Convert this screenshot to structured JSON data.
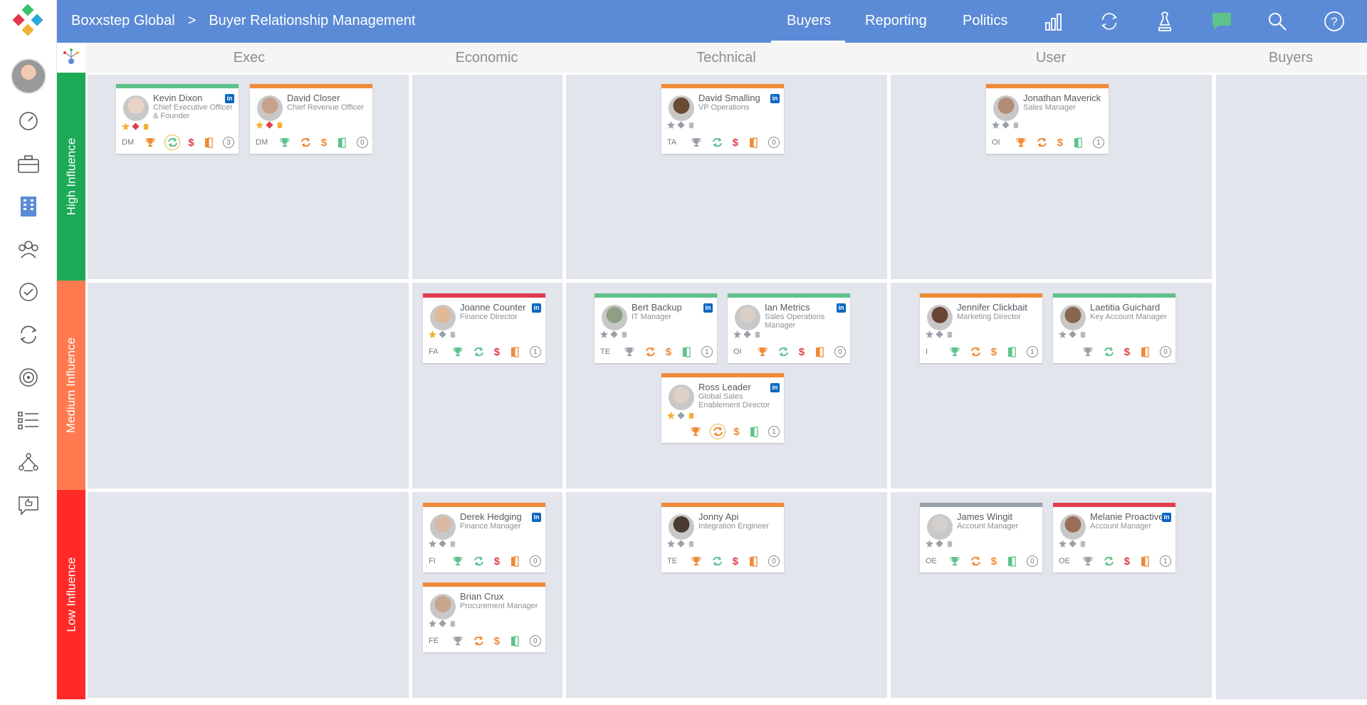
{
  "header": {
    "org": "Boxxstep Global",
    "separator": ">",
    "page": "Buyer Relationship Management",
    "tabs": [
      "Buyers",
      "Reporting",
      "Politics"
    ],
    "active_tab": "Buyers"
  },
  "columns": [
    "Exec",
    "Economic",
    "Technical",
    "User",
    "Buyers"
  ],
  "rows": [
    {
      "label": "High Influence",
      "color": "#1daa57"
    },
    {
      "label": "Medium Influence",
      "color": "#ff7a4e"
    },
    {
      "label": "Low Influence",
      "color": "#ff2a27"
    }
  ],
  "colors": {
    "topbar": "#5b8bd6",
    "green": "#5fc28c",
    "orange": "#ef8b38",
    "red": "#e23d4e",
    "gray": "#9aa0a8",
    "cell": "#e3e5ec"
  },
  "cards": [
    {
      "name": "Kevin Dixon",
      "title": "Chief Executive Officer & Founder",
      "code": "DM",
      "count": "3",
      "bar": "green",
      "linkedin": true,
      "photo_tone": "#e9d3c6"
    },
    {
      "name": "David Closer",
      "title": "Chief Revenue Officer",
      "code": "DM",
      "count": "0",
      "bar": "orange",
      "linkedin": false,
      "photo_tone": "#c7a28a"
    },
    {
      "name": "David Smalling",
      "title": "VP Operations",
      "code": "TA",
      "count": "0",
      "bar": "orange",
      "linkedin": true,
      "photo_tone": "#6b4a36"
    },
    {
      "name": "Jonathan Maverick",
      "title": "Sales Manager",
      "code": "OI",
      "count": "1",
      "bar": "orange",
      "linkedin": false,
      "photo_tone": "#b18b73"
    },
    {
      "name": "Joanne Counter",
      "title": "Finance Director",
      "code": "FA",
      "count": "1",
      "bar": "red",
      "linkedin": true,
      "photo_tone": "#e1b997"
    },
    {
      "name": "Bert Backup",
      "title": "IT Manager",
      "code": "TE",
      "count": "1",
      "bar": "green",
      "linkedin": true,
      "photo_tone": "#8e9f86"
    },
    {
      "name": "Ian Metrics",
      "title": "Sales Operations Manager",
      "code": "OI",
      "count": "0",
      "bar": "green",
      "linkedin": true,
      "photo_tone": "#d7cfc8"
    },
    {
      "name": "Jennifer Clickbait",
      "title": "Marketing Director",
      "code": "I",
      "count": "1",
      "bar": "orange",
      "linkedin": false,
      "photo_tone": "#6a4534"
    },
    {
      "name": "Laetitia Guichard",
      "title": "Key Account Manager",
      "code": "",
      "count": "0",
      "bar": "green",
      "linkedin": false,
      "photo_tone": "#8a6650"
    },
    {
      "name": "Ross Leader",
      "title": "Global Sales Enablement Director",
      "code": "",
      "count": "1",
      "bar": "orange",
      "linkedin": true,
      "photo_tone": "#ddd0c7"
    },
    {
      "name": "Derek Hedging",
      "title": "Finance Manager",
      "code": "FI",
      "count": "0",
      "bar": "orange",
      "linkedin": true,
      "photo_tone": "#d9b8a4"
    },
    {
      "name": "Brian Crux",
      "title": "Procurement Manager",
      "code": "FE",
      "count": "0",
      "bar": "orange",
      "linkedin": false,
      "photo_tone": "#c9a58e"
    },
    {
      "name": "Jonny Api",
      "title": "Integration Engineer",
      "code": "TE",
      "count": "0",
      "bar": "orange",
      "linkedin": false,
      "photo_tone": "#4a3a30"
    },
    {
      "name": "James Wingit",
      "title": "Account Manager",
      "code": "OE",
      "count": "0",
      "bar": "gray",
      "linkedin": false,
      "photo_tone": "#d4cfcb"
    },
    {
      "name": "Melanie Proactive",
      "title": "Account Manager",
      "code": "OE",
      "count": "1",
      "bar": "red",
      "linkedin": true,
      "photo_tone": "#9a6e55"
    }
  ],
  "icons": {
    "sidebar": [
      "dashboard-gauge-icon",
      "briefcase-icon",
      "building-icon",
      "team-icon",
      "checkmark-icon",
      "cycle-icon",
      "target-icon",
      "checklist-icon",
      "org-chart-icon",
      "feedback-icon"
    ],
    "topbar": [
      "chart-icon",
      "refresh-icon",
      "chess-icon",
      "chat-icon",
      "search-icon",
      "help-icon"
    ]
  }
}
